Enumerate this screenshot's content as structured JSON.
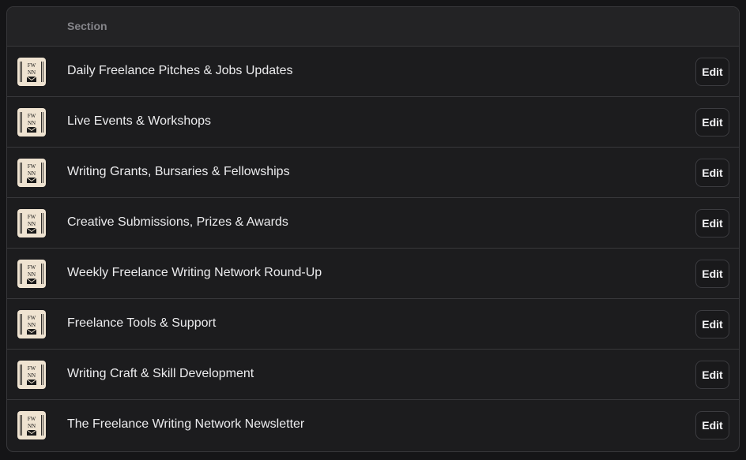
{
  "table": {
    "header": {
      "section_label": "Section"
    },
    "rows": [
      {
        "label": "Daily Freelance Pitches & Jobs Updates",
        "edit_label": "Edit",
        "icon": "fwn-newsletter-logo"
      },
      {
        "label": "Live Events & Workshops",
        "edit_label": "Edit",
        "icon": "fwn-newsletter-logo"
      },
      {
        "label": "Writing Grants, Bursaries & Fellowships",
        "edit_label": "Edit",
        "icon": "fwn-newsletter-logo"
      },
      {
        "label": "Creative Submissions, Prizes & Awards",
        "edit_label": "Edit",
        "icon": "fwn-newsletter-logo"
      },
      {
        "label": "Weekly Freelance Writing Network Round-Up",
        "edit_label": "Edit",
        "icon": "fwn-newsletter-logo"
      },
      {
        "label": "Freelance Tools & Support",
        "edit_label": "Edit",
        "icon": "fwn-newsletter-logo"
      },
      {
        "label": "Writing Craft & Skill Development",
        "edit_label": "Edit",
        "icon": "fwn-newsletter-logo"
      },
      {
        "label": "The Freelance Writing Network Newsletter",
        "edit_label": "Edit",
        "icon": "fwn-newsletter-logo"
      }
    ],
    "logo_text": {
      "line1": "FW",
      "line2": "NN"
    }
  },
  "colors": {
    "background": "#151517",
    "surface": "#1c1c1e",
    "header_surface": "#232325",
    "border": "#38383b",
    "text": "#ececee",
    "muted_text": "#85858a",
    "logo_bg": "#efe3d1"
  }
}
